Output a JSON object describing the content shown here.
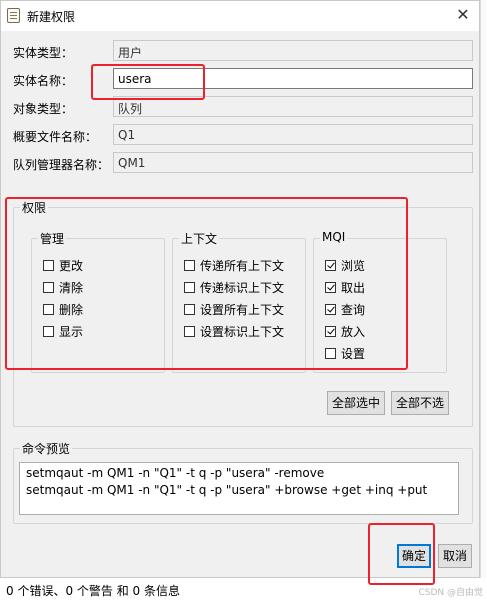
{
  "window": {
    "title": "新建权限",
    "close_glyph": "✕"
  },
  "form": {
    "entity_type": {
      "label": "实体类型：",
      "value": "用户"
    },
    "entity_name": {
      "label": "实体名称：",
      "value": "usera"
    },
    "object_type": {
      "label": "对象类型：",
      "value": "队列"
    },
    "profile_name": {
      "label": "概要文件名称：",
      "value": "Q1"
    },
    "qmgr_name": {
      "label": "队列管理器名称：",
      "value": "QM1"
    }
  },
  "permissions": {
    "title": "权限",
    "management": {
      "title": "管理",
      "items": [
        {
          "label": "更改",
          "checked": false
        },
        {
          "label": "清除",
          "checked": false
        },
        {
          "label": "删除",
          "checked": false
        },
        {
          "label": "显示",
          "checked": false
        }
      ]
    },
    "context": {
      "title": "上下文",
      "items": [
        {
          "label": "传递所有上下文",
          "checked": false
        },
        {
          "label": "传递标识上下文",
          "checked": false
        },
        {
          "label": "设置所有上下文",
          "checked": false
        },
        {
          "label": "设置标识上下文",
          "checked": false
        }
      ]
    },
    "mqi": {
      "title": "MQI",
      "items": [
        {
          "label": "浏览",
          "checked": true
        },
        {
          "label": "取出",
          "checked": true
        },
        {
          "label": "查询",
          "checked": true
        },
        {
          "label": "放入",
          "checked": true
        },
        {
          "label": "设置",
          "checked": false
        }
      ]
    },
    "select_all_label": "全部选中",
    "deselect_all_label": "全部不选"
  },
  "command_preview": {
    "title": "命令预览",
    "lines": [
      "setmqaut -m QM1 -n \"Q1\" -t q -p \"usera\" -remove",
      "setmqaut -m QM1 -n \"Q1\" -t q -p \"usera\" +browse +get +inq +put"
    ]
  },
  "buttons": {
    "ok": "确定",
    "cancel": "取消"
  },
  "status": "0 个错误、0 个警告 和 0 条信息",
  "watermark": "CSDN @自由觉",
  "colors": {
    "highlight": "#e8232d",
    "default_button_border": "#0078d7"
  }
}
